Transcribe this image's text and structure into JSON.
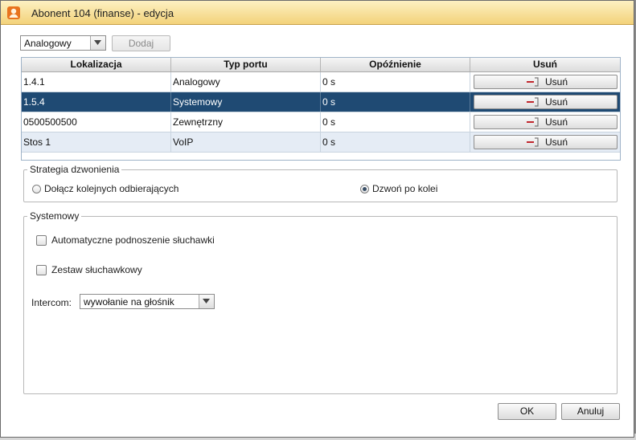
{
  "window": {
    "title": "Abonent 104 (finanse) - edycja"
  },
  "toolbar": {
    "port_type_value": "Analogowy",
    "add_label": "Dodaj"
  },
  "table": {
    "columns": [
      "Lokalizacja",
      "Typ portu",
      "Opóźnienie",
      "Usuń"
    ],
    "rows": [
      {
        "lokalizacja": "1.4.1",
        "typ": "Analogowy",
        "opoznienie": "0 s",
        "usun": "Usuń"
      },
      {
        "lokalizacja": "1.5.4",
        "typ": "Systemowy",
        "opoznienie": "0 s",
        "usun": "Usuń"
      },
      {
        "lokalizacja": "0500500500",
        "typ": "Zewnętrzny",
        "opoznienie": "0 s",
        "usun": "Usuń"
      },
      {
        "lokalizacja": "Stos 1",
        "typ": "VoIP",
        "opoznienie": "0 s",
        "usun": "Usuń"
      }
    ]
  },
  "strategy": {
    "legend": "Strategia dzwonienia",
    "option1": "Dołącz kolejnych odbierających",
    "option2": "Dzwoń po kolei",
    "selected": "option2"
  },
  "systemowy": {
    "legend": "Systemowy",
    "auto_pickup": "Automatyczne podnoszenie słuchawki",
    "auto_pickup_checked": false,
    "headset": "Zestaw słuchawkowy",
    "headset_checked": false,
    "intercom_label": "Intercom:",
    "intercom_value": "wywołanie na głośnik"
  },
  "footer": {
    "ok_label": "OK",
    "cancel_label": "Anuluj"
  },
  "colors": {
    "selected_row": "#1f4a73",
    "alt_row": "#e5ecf5",
    "title_bar": "#f3d27a"
  }
}
